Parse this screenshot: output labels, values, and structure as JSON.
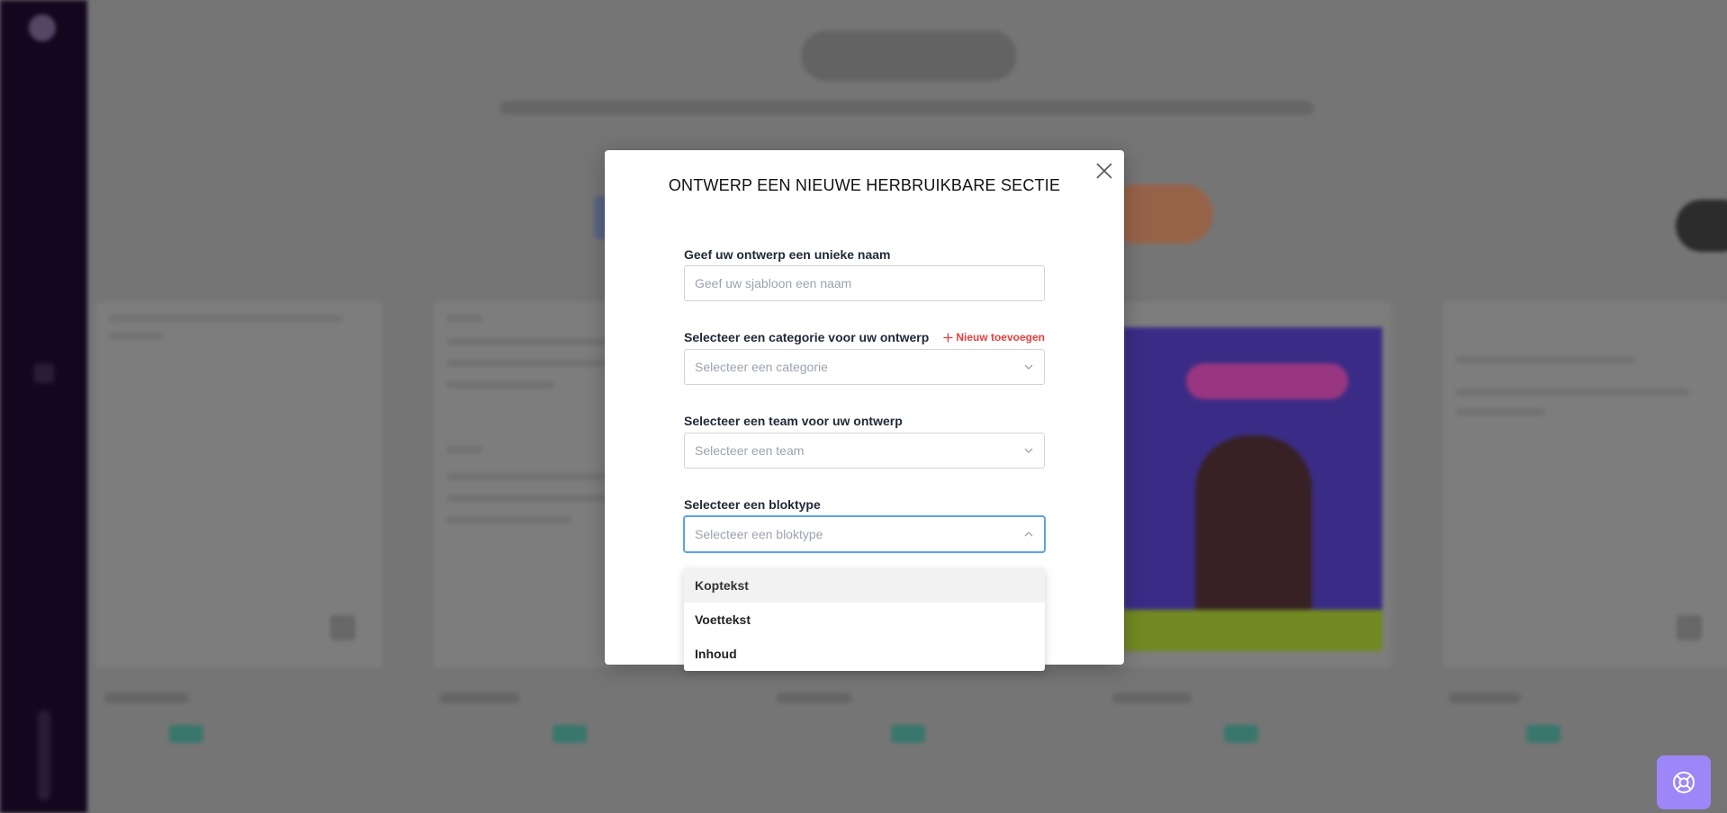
{
  "modal": {
    "title": "ONTWERP EEN NIEUWE HERBRUIKBARE SECTIE",
    "name_label": "Geef uw ontwerp een unieke naam",
    "name_placeholder": "Geef uw sjabloon een naam",
    "name_value": "",
    "category_label": "Selecteer een categorie voor uw ontwerp",
    "add_new_label": "Nieuw toevoegen",
    "category_placeholder": "Selecteer een categorie",
    "team_label": "Selecteer een team voor uw ontwerp",
    "team_placeholder": "Selecteer een team",
    "blocktype_label": "Selecteer een bloktype",
    "blocktype_placeholder": "Selecteer een bloktype"
  },
  "dropdown": {
    "options": [
      "Koptekst",
      "Voettekst",
      "Inhoud"
    ],
    "highlighted_index": 0
  },
  "icons": {
    "close": "close-icon",
    "add": "plus-icon",
    "chevron_down": "chevron-down-icon",
    "chevron_up": "chevron-up-icon",
    "help": "lifebuoy-icon"
  },
  "colors": {
    "accent_red": "#e53e3e",
    "focus_blue": "#5aa3e0",
    "help_purple": "#9d86f7",
    "sidebar_dark": "#170722"
  }
}
